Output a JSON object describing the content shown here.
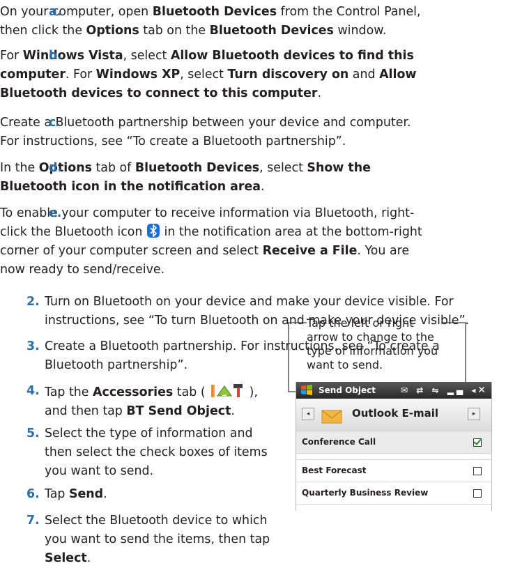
{
  "sub_steps": [
    {
      "num": "a.",
      "segments": [
        {
          "t": "On your computer, open ",
          "b": false
        },
        {
          "t": "Bluetooth Devices",
          "b": true
        },
        {
          "t": " from the Control Panel, then click the ",
          "b": false
        },
        {
          "t": "Options",
          "b": true
        },
        {
          "t": " tab on the ",
          "b": false
        },
        {
          "t": "Bluetooth Devices",
          "b": true
        },
        {
          "t": " window.",
          "b": false
        }
      ]
    },
    {
      "num": "b.",
      "segments": [
        {
          "t": "For ",
          "b": false
        },
        {
          "t": "Windows Vista",
          "b": true
        },
        {
          "t": ", select ",
          "b": false
        },
        {
          "t": "Allow Bluetooth devices to find this computer",
          "b": true
        },
        {
          "t": ". For ",
          "b": false
        },
        {
          "t": "Windows XP",
          "b": true
        },
        {
          "t": ", select ",
          "b": false
        },
        {
          "t": "Turn discovery on",
          "b": true
        },
        {
          "t": " and ",
          "b": false
        },
        {
          "t": "Allow Bluetooth devices to connect to this computer",
          "b": true
        },
        {
          "t": ".",
          "b": false
        }
      ]
    },
    {
      "num": "c.",
      "segments": [
        {
          "t": "Create a Bluetooth partnership between your device and computer. For instructions, see “To create a Bluetooth partnership”.",
          "b": false
        }
      ]
    },
    {
      "num": "d.",
      "segments": [
        {
          "t": "In the ",
          "b": false
        },
        {
          "t": "Options",
          "b": true
        },
        {
          "t": " tab of ",
          "b": false
        },
        {
          "t": "Bluetooth Devices",
          "b": true
        },
        {
          "t": ", select ",
          "b": false
        },
        {
          "t": "Show the Bluetooth icon in the notification area",
          "b": true
        },
        {
          "t": ".",
          "b": false
        }
      ]
    },
    {
      "num": "e.",
      "segments": [
        {
          "t": "To enable your computer to receive information via Bluetooth, right-click the Bluetooth icon ",
          "b": false
        },
        {
          "icon": "bluetooth-icon"
        },
        {
          "t": " in the notification area at the bottom-right corner of your computer screen and select ",
          "b": false
        },
        {
          "t": "Receive a File",
          "b": true
        },
        {
          "t": ". You are now ready to send/receive.",
          "b": false
        }
      ]
    }
  ],
  "steps": [
    {
      "num": "2.",
      "segments": [
        {
          "t": "Turn on Bluetooth on your device and make your device visible. For instructions, see “To turn Bluetooth on and make your device visible”.",
          "b": false
        }
      ]
    },
    {
      "num": "3.",
      "segments": [
        {
          "t": "Create a Bluetooth partnership. For instructions, see “To create a Bluetooth partnership”.",
          "b": false
        }
      ]
    },
    {
      "num": "4.",
      "segments": [
        {
          "t": "Tap the ",
          "b": false
        },
        {
          "t": "Accessories",
          "b": true
        },
        {
          "t": " tab ( ",
          "b": false
        },
        {
          "icon": "accessories-tab-icon"
        },
        {
          "t": " ), and then tap ",
          "b": false
        },
        {
          "t": "BT Send Object",
          "b": true
        },
        {
          "t": ".",
          "b": false
        }
      ]
    },
    {
      "num": "5.",
      "segments": [
        {
          "t": "Select the type of information and then select the check boxes of items you want to send.",
          "b": false
        }
      ]
    },
    {
      "num": "6.",
      "segments": [
        {
          "t": "Tap ",
          "b": false
        },
        {
          "t": "Send",
          "b": true
        },
        {
          "t": ".",
          "b": false
        }
      ]
    },
    {
      "num": "7.",
      "segments": [
        {
          "t": "Select the Bluetooth device to which you want to send the items, then tap ",
          "b": false
        },
        {
          "t": "Select",
          "b": true
        },
        {
          "t": ".",
          "b": false
        }
      ]
    }
  ],
  "callout": {
    "text": "Tap the left or right arrow to change to the type of information you want to send."
  },
  "phone": {
    "title": "Send Object",
    "status_icons": [
      "envelope-icon",
      "battery-icon",
      "sync-icon",
      "signal-icon",
      "volume-icon"
    ],
    "close_label": "✕",
    "left_arrow": "◂",
    "right_arrow": "▸",
    "info_type": "Outlook E-mail",
    "items": [
      {
        "label": "Conference Call",
        "checked": true
      },
      {
        "label": "Best Forecast",
        "checked": false
      },
      {
        "label": "Quarterly Business Review",
        "checked": false
      }
    ]
  },
  "colors": {
    "number_blue": "#2e6ea6",
    "check_green": "#1e8a1e",
    "bluetooth_blue": "#1a6fd6"
  }
}
